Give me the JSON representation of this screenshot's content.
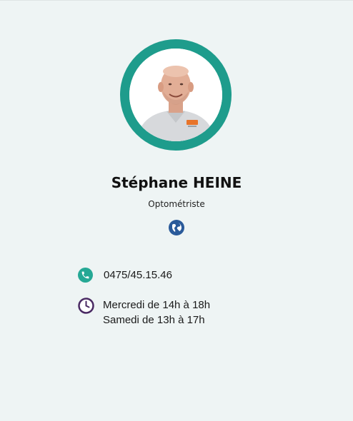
{
  "profile": {
    "name": "Stéphane HEINE",
    "role": "Optométriste",
    "avatar_alt": "Stéphane HEINE"
  },
  "contact": {
    "phone": "0475/45.15.46",
    "hours": [
      "Mercredi de 14h à 18h",
      "Samedi de 13h à 17h"
    ]
  },
  "icons": {
    "website": "globe-icon",
    "phone": "phone-icon",
    "hours": "clock-icon"
  },
  "colors": {
    "background": "#eef4f4",
    "ring": "#1e9c8c",
    "phone_icon": "#25a895",
    "clock_icon": "#4a2a63",
    "globe_icon": "#2a5a9a"
  }
}
